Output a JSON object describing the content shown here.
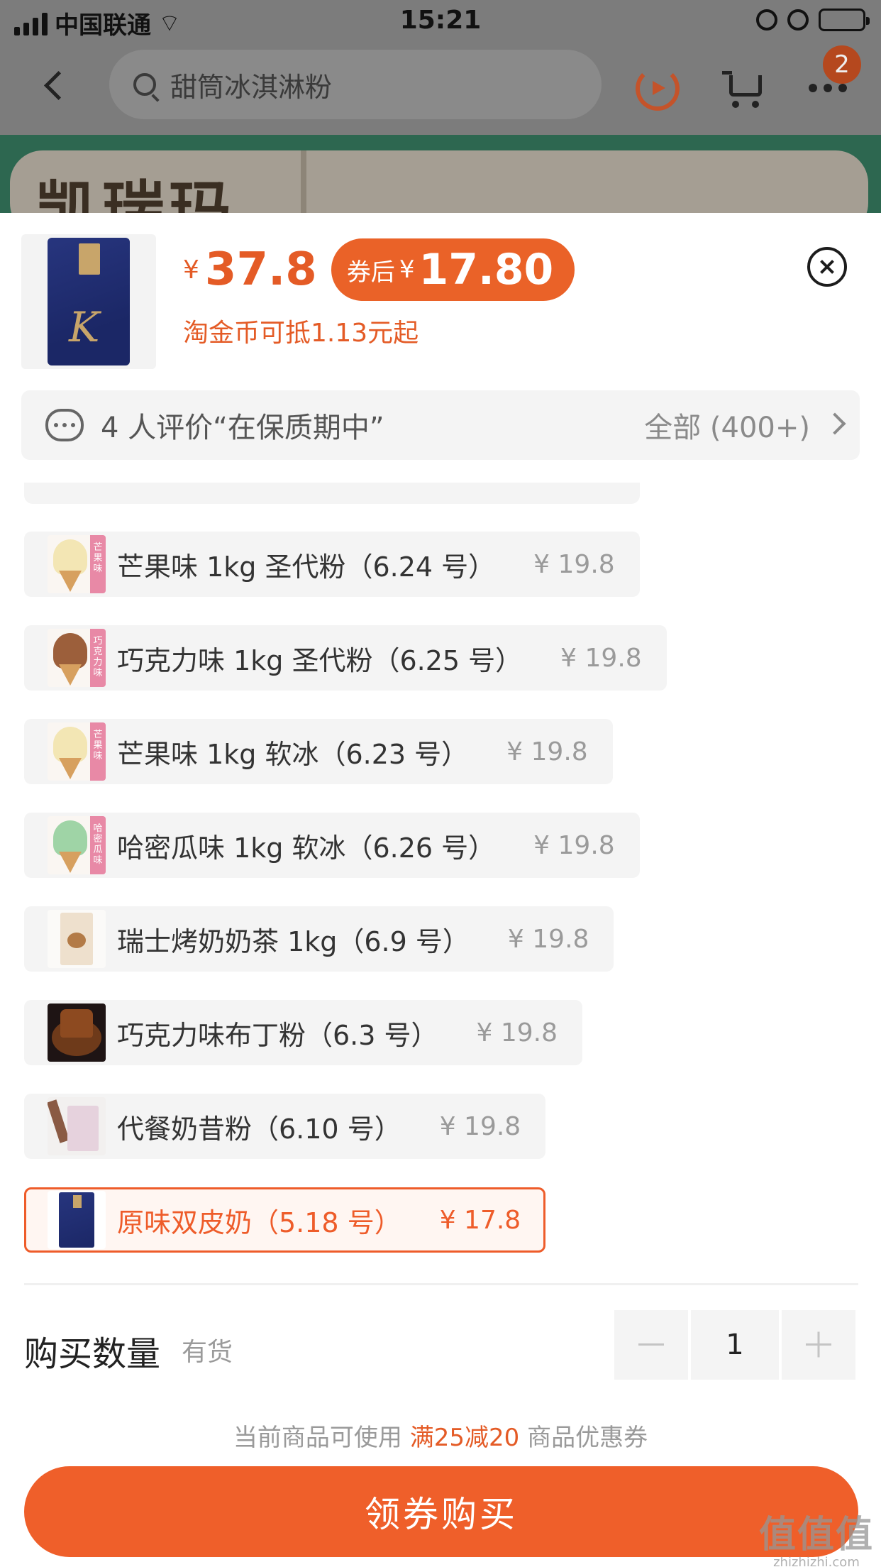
{
  "status_bar": {
    "carrier": "中国联通",
    "time": "15:21"
  },
  "nav": {
    "search_placeholder": "甜筒冰淇淋粉",
    "badge_count": "2"
  },
  "banner": {
    "text": "凯瑞玛"
  },
  "product": {
    "yen": "¥",
    "price": "37.8",
    "coupon_label": "券后",
    "coupon_yen": "¥",
    "coupon_price": "17.80",
    "coin_text": "淘金币可抵1.13元起"
  },
  "review": {
    "text": "4 人评价“在保质期中”",
    "all": "全部 (400+)"
  },
  "options": [
    {
      "name": "芒果味 1kg 圣代粉（6.24 号）",
      "price": "¥ 19.8",
      "tag": "芒果味"
    },
    {
      "name": "巧克力味 1kg 圣代粉（6.25 号）",
      "price": "¥ 19.8",
      "tag": "巧克力味"
    },
    {
      "name": "芒果味 1kg 软冰（6.23 号）",
      "price": "¥ 19.8",
      "tag": "芒果味"
    },
    {
      "name": "哈密瓜味 1kg 软冰（6.26 号）",
      "price": "¥ 19.8",
      "tag": "哈密瓜味"
    },
    {
      "name": "瑞士烤奶奶茶 1kg（6.9 号）",
      "price": "¥ 19.8"
    },
    {
      "name": "巧克力味布丁粉（6.3 号）",
      "price": "¥ 19.8"
    },
    {
      "name": "代餐奶昔粉（6.10 号）",
      "price": "¥ 19.8"
    },
    {
      "name": "原味双皮奶（5.18 号）",
      "price": "¥ 17.8",
      "selected": true
    }
  ],
  "quantity": {
    "label": "购买数量",
    "stock": "有货",
    "value": "1"
  },
  "coupon_note": {
    "prefix": "当前商品可使用",
    "highlight": "满25减20",
    "suffix": "商品优惠券"
  },
  "buy_button": "领券购买",
  "watermark": {
    "main": "值值值",
    "sub": "zhizhizhi.com"
  },
  "colors": {
    "accent": "#ef5f2a",
    "price": "#e45b26",
    "selected_bg": "#fff6f2"
  },
  "icons": [
    "back-icon",
    "search-icon",
    "refresh-icon",
    "cart-icon",
    "more-icon",
    "close-icon",
    "chat-icon",
    "chevron-right-icon"
  ]
}
